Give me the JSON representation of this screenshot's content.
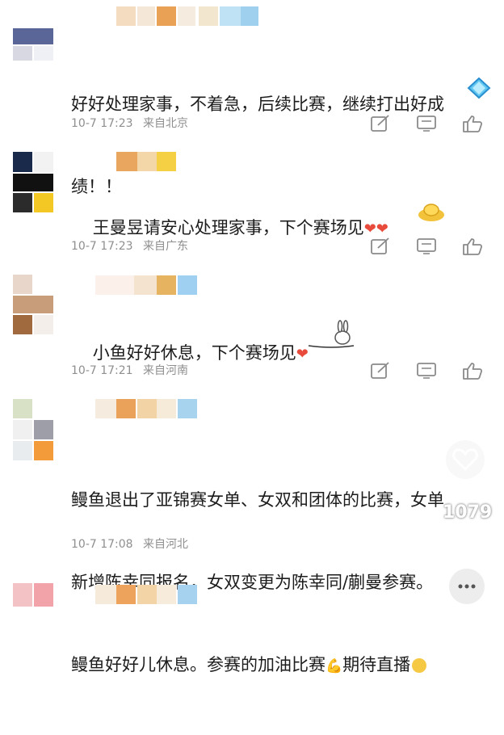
{
  "comments": [
    {
      "text_line1": "好好处理家事，不着急，后续比赛，继续打出好成",
      "text_line2": "绩！！",
      "date": "10-7 17:23",
      "location": "来自北京"
    },
    {
      "text": "王曼昱请安心处理家事，下个赛场见",
      "date": "10-7 17:23",
      "location": "来自广东"
    },
    {
      "text": "小鱼好好休息，下个赛场见",
      "date": "10-7 17:21",
      "location": "来自河南"
    },
    {
      "text_line1": "鳗鱼退出了亚锦赛女单、女双和团体的比赛，女单",
      "text_line2": "新增陈幸同报名，女双变更为陈幸同/蒯曼参赛。",
      "text_line3": "鳗鱼好好儿休息。参赛的加油比赛",
      "text_line3b": "期待直播",
      "date": "10-7 17:08",
      "location": "来自河北"
    }
  ],
  "like_count_badge": "1079",
  "icons": [
    "forward-icon",
    "comment-icon",
    "like-icon"
  ],
  "colors": {
    "text": "#1c1c1c",
    "meta": "#8f8f8f",
    "heart": "#e84b3c"
  }
}
